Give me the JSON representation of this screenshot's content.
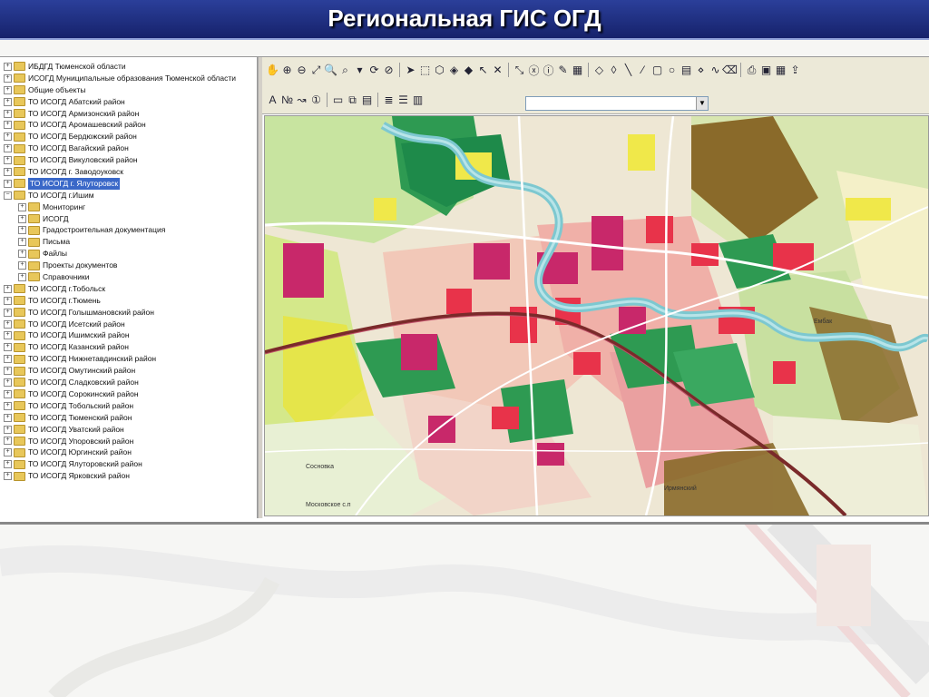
{
  "slide": {
    "title": "Региональная ГИС ОГД"
  },
  "tree": {
    "items": [
      {
        "label": "ИБДГД Тюменской области",
        "level": 0,
        "expanded": false
      },
      {
        "label": "ИСОГД  Муниципальные образования Тюменской области",
        "level": 0,
        "expanded": false
      },
      {
        "label": "Общие объекты",
        "level": 0,
        "expanded": false
      },
      {
        "label": "ТО ИСОГД Абатский район",
        "level": 0,
        "expanded": false
      },
      {
        "label": "ТО ИСОГД Армизонский район",
        "level": 0,
        "expanded": false
      },
      {
        "label": "ТО ИСОГД Аромашевский район",
        "level": 0,
        "expanded": false
      },
      {
        "label": "ТО ИСОГД Бердюжский район",
        "level": 0,
        "expanded": false
      },
      {
        "label": "ТО ИСОГД Вагайский район",
        "level": 0,
        "expanded": false
      },
      {
        "label": "ТО ИСОГД Викуловский район",
        "level": 0,
        "expanded": false
      },
      {
        "label": "ТО ИСОГД г. Заводоуковск",
        "level": 0,
        "expanded": false
      },
      {
        "label": "ТО ИСОГД г. Ялуторовск",
        "level": 0,
        "expanded": false,
        "selected": true
      },
      {
        "label": "ТО ИСОГД г.Ишим",
        "level": 0,
        "expanded": true
      },
      {
        "label": "Мониторинг",
        "level": 1,
        "expanded": false
      },
      {
        "label": "ИСОГД",
        "level": 1,
        "expanded": false
      },
      {
        "label": "Градостроительная документация",
        "level": 1,
        "expanded": false
      },
      {
        "label": "Письма",
        "level": 1,
        "expanded": false
      },
      {
        "label": "Файлы",
        "level": 1,
        "expanded": false
      },
      {
        "label": "Проекты документов",
        "level": 1,
        "expanded": false
      },
      {
        "label": "Справочники",
        "level": 1,
        "expanded": false
      },
      {
        "label": "ТО ИСОГД г.Тобольск",
        "level": 0,
        "expanded": false
      },
      {
        "label": "ТО ИСОГД г.Тюмень",
        "level": 0,
        "expanded": false
      },
      {
        "label": "ТО ИСОГД Голышмановский район",
        "level": 0,
        "expanded": false
      },
      {
        "label": "ТО ИСОГД Исетский район",
        "level": 0,
        "expanded": false
      },
      {
        "label": "ТО ИСОГД Ишимский район",
        "level": 0,
        "expanded": false
      },
      {
        "label": "ТО ИСОГД Казанский район",
        "level": 0,
        "expanded": false
      },
      {
        "label": "ТО ИСОГД Нижнетавдинский район",
        "level": 0,
        "expanded": false
      },
      {
        "label": "ТО ИСОГД Омутинский район",
        "level": 0,
        "expanded": false
      },
      {
        "label": "ТО ИСОГД Сладковский район",
        "level": 0,
        "expanded": false
      },
      {
        "label": "ТО ИСОГД Сорокинский район",
        "level": 0,
        "expanded": false
      },
      {
        "label": "ТО ИСОГД Тобольский район",
        "level": 0,
        "expanded": false
      },
      {
        "label": "ТО ИСОГД Тюменский район",
        "level": 0,
        "expanded": false
      },
      {
        "label": "ТО ИСОГД Уватский район",
        "level": 0,
        "expanded": false
      },
      {
        "label": "ТО ИСОГД Упоровский район",
        "level": 0,
        "expanded": false
      },
      {
        "label": "ТО ИСОГД Юргинский район",
        "level": 0,
        "expanded": false
      },
      {
        "label": "ТО ИСОГД Ялуторовский район",
        "level": 0,
        "expanded": false
      },
      {
        "label": "ТО ИСОГД Ярковский район",
        "level": 0,
        "expanded": false
      }
    ]
  },
  "toolbar": {
    "row1_icons": [
      "pan-icon",
      "zoom-in-icon",
      "zoom-out-icon",
      "zoom-extent-icon",
      "zoom-select-icon",
      "zoom-window-icon",
      "zoom-dropdown-icon",
      "refresh-icon",
      "stop-icon",
      "select-arrow-icon",
      "select-rect-icon",
      "select-polygon-icon",
      "select-layer-icon",
      "select-point-icon",
      "select-by-icon",
      "select-clear-icon",
      "measure-icon",
      "coord-xy-icon",
      "info-icon",
      "edit-icon",
      "scale-icon",
      "draw-polygon-icon",
      "draw-poly2-icon",
      "draw-line-icon",
      "draw-slash-icon",
      "draw-rect-icon",
      "draw-circle-icon",
      "draw-grid-icon",
      "draw-vertex-icon",
      "draw-curve-icon",
      "erase-icon",
      "print-icon",
      "map-layers-icon",
      "table-icon",
      "export-icon"
    ],
    "row2_icons": [
      "label-icon",
      "number-icon",
      "route-icon",
      "info-circle-icon",
      "document-icon",
      "copy-icon",
      "paste-icon",
      "legend-icon",
      "report-icon",
      "chart-icon"
    ],
    "combo_value": ""
  },
  "map": {
    "labels": [
      "Ембак",
      "Московское с.п",
      "Сосновка",
      "Ирмянский"
    ]
  },
  "colors": {
    "title_bar": "#1e2d82",
    "residential": "#f2b8a8",
    "commercial": "#e8334a",
    "green": "#2e9a52",
    "light_green": "#c8e4a0",
    "industrial": "#8a6a2a",
    "water": "#7dc8d0",
    "selection": "#3a68c8"
  }
}
